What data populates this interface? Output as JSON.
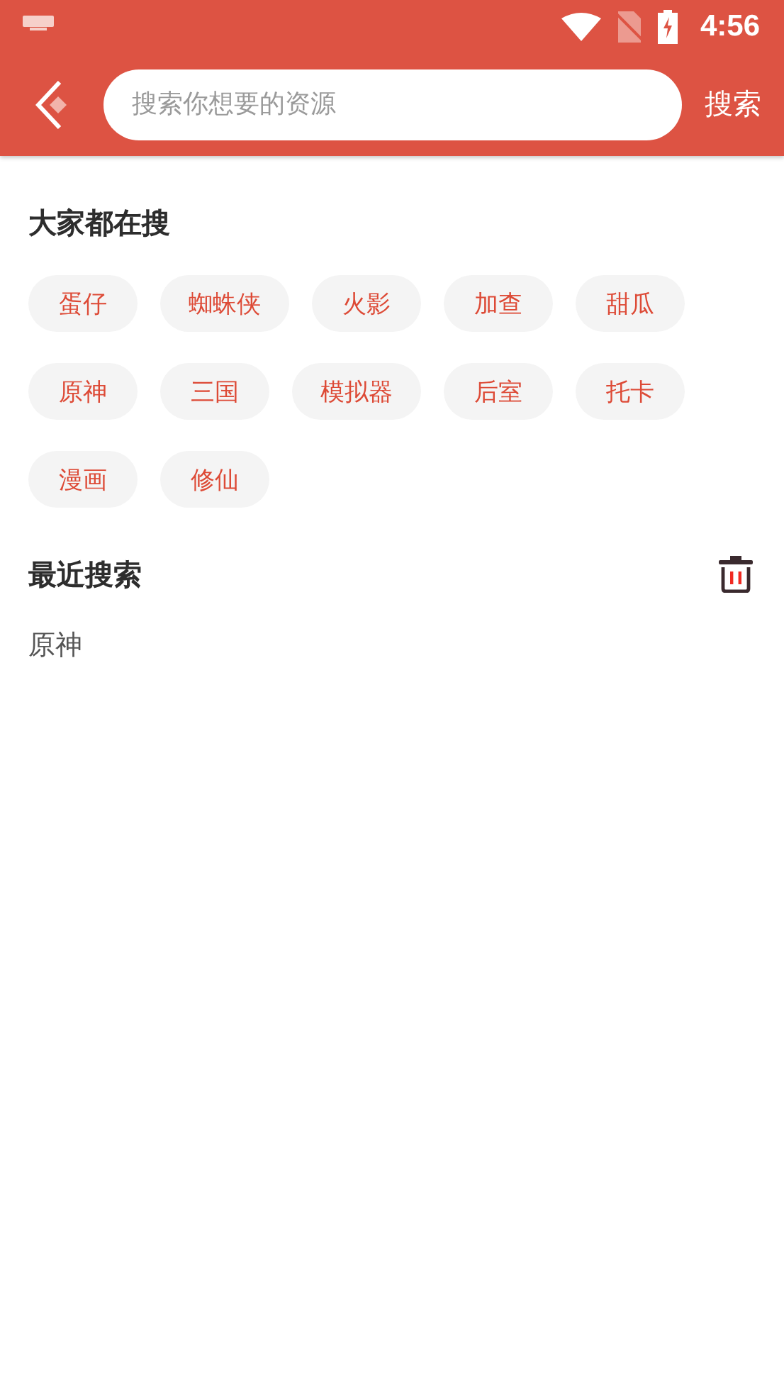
{
  "status_bar": {
    "time": "4:56"
  },
  "toolbar": {
    "search": {
      "placeholder": "搜索你想要的资源"
    },
    "search_button": "搜索"
  },
  "hot": {
    "title": "大家都在搜",
    "tags": [
      "蛋仔",
      "蜘蛛侠",
      "火影",
      "加查",
      "甜瓜",
      "原神",
      "三国",
      "模拟器",
      "后室",
      "托卡",
      "漫画",
      "修仙"
    ]
  },
  "recent": {
    "title": "最近搜索",
    "items": [
      "原神"
    ]
  }
}
